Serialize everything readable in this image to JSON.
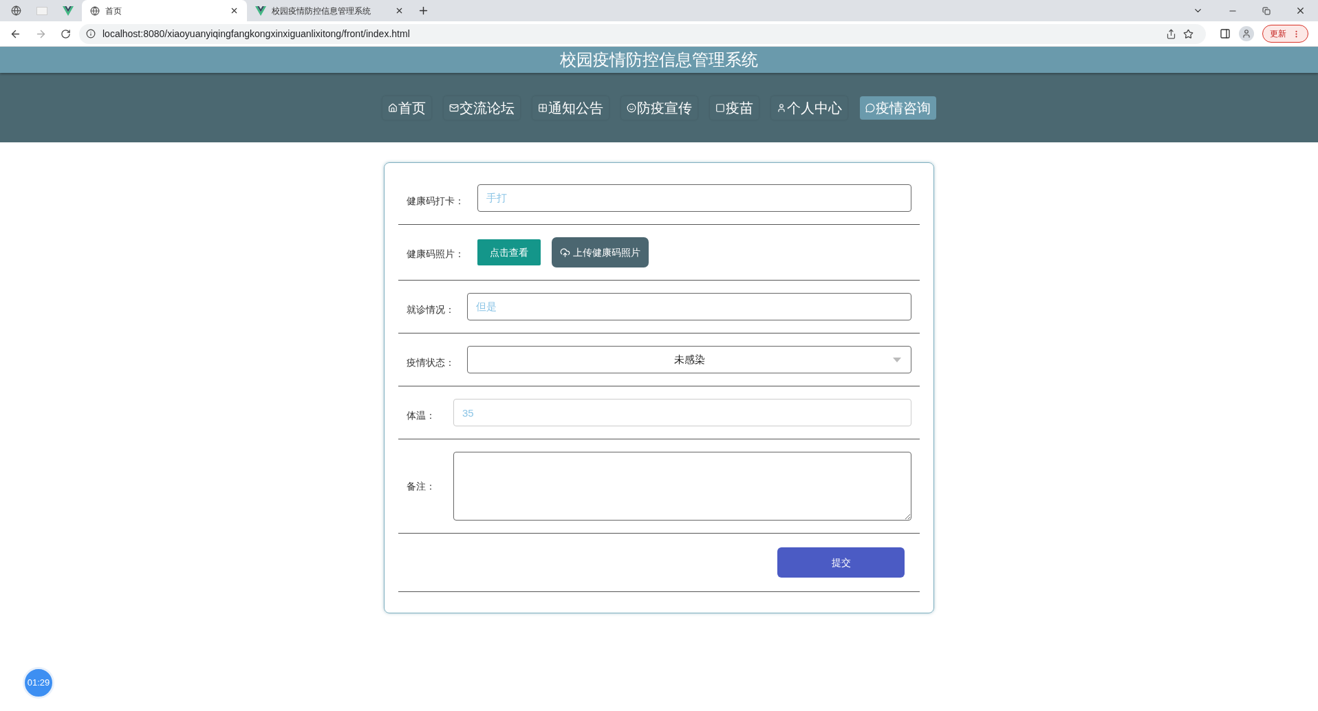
{
  "browser": {
    "tabs": [
      {
        "title": "首页",
        "selected": true
      },
      {
        "title": "校园疫情防控信息管理系统",
        "selected": false
      }
    ],
    "url": "localhost:8080/xiaoyuanyiqingfangkongxinxiguanlixitong/front/index.html",
    "update_button": "更新"
  },
  "header": {
    "title": "校园疫情防控信息管理系统"
  },
  "nav": [
    {
      "label": "首页",
      "selected": false
    },
    {
      "label": "交流论坛",
      "selected": false
    },
    {
      "label": "通知公告",
      "selected": false
    },
    {
      "label": "防疫宣传",
      "selected": false
    },
    {
      "label": "疫苗",
      "selected": false
    },
    {
      "label": "个人中心",
      "selected": false
    },
    {
      "label": "疫情咨询",
      "selected": true
    }
  ],
  "form": {
    "rows": [
      {
        "kind": "text",
        "label": "健康码打卡：",
        "value": "手打"
      },
      {
        "kind": "buttons",
        "label": "健康码照片：",
        "buttons": [
          "点击查看",
          "上传健康码照片"
        ]
      },
      {
        "kind": "text",
        "label": "就诊情况：",
        "value": "但是"
      },
      {
        "kind": "select",
        "label": "疫情状态：",
        "value": "未感染"
      },
      {
        "kind": "text",
        "label": "体温：",
        "value": "35"
      },
      {
        "kind": "textarea",
        "label": "备注："
      }
    ],
    "submit": "提交"
  },
  "timer": "01:29"
}
